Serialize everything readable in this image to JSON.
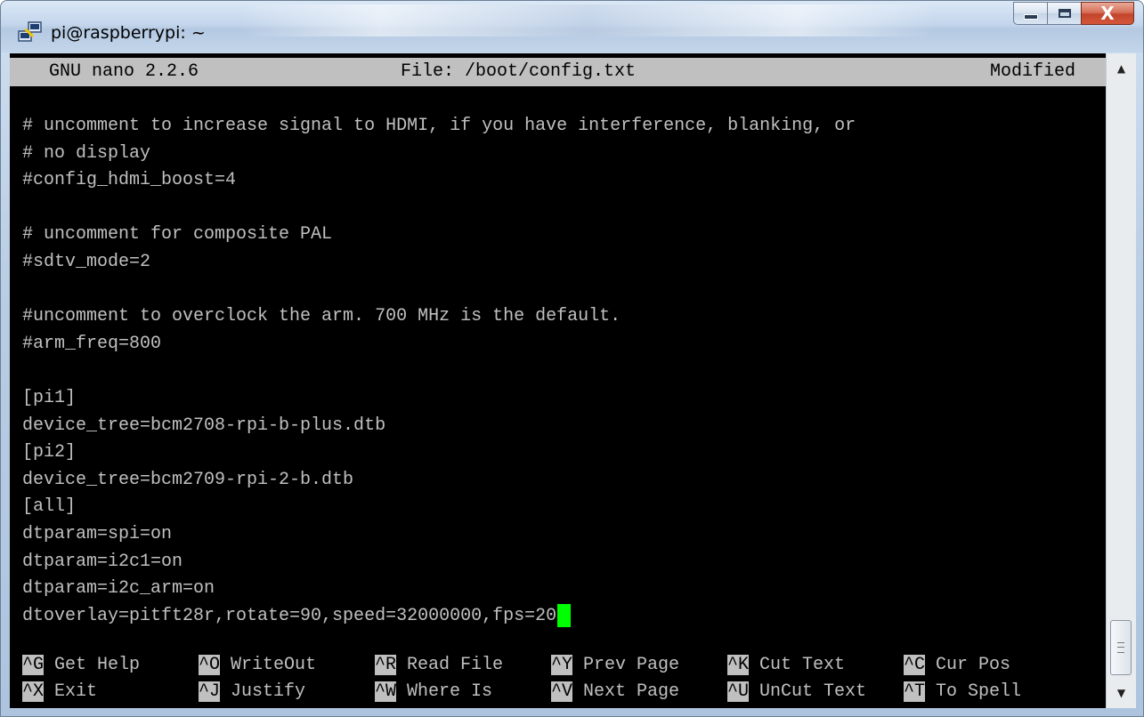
{
  "window": {
    "title": "pi@raspberrypi: ~",
    "minimize_glyph": "minimize-icon",
    "maximize_glyph": "maximize-icon",
    "close_label": "X"
  },
  "nano": {
    "version": "GNU nano 2.2.6",
    "file": "File: /boot/config.txt",
    "status": "Modified"
  },
  "lines": [
    "# uncomment to increase signal to HDMI, if you have interference, blanking, or",
    "# no display",
    "#config_hdmi_boost=4",
    "",
    "# uncomment for composite PAL",
    "#sdtv_mode=2",
    "",
    "#uncomment to overclock the arm. 700 MHz is the default.",
    "#arm_freq=800",
    "",
    "[pi1]",
    "device_tree=bcm2708-rpi-b-plus.dtb",
    "[pi2]",
    "device_tree=bcm2709-rpi-2-b.dtb",
    "[all]",
    "dtparam=spi=on",
    "dtparam=i2c1=on",
    "dtparam=i2c_arm=on",
    "dtoverlay=pitft28r,rotate=90,speed=32000000,fps=20"
  ],
  "shortcuts": [
    {
      "key": "^G",
      "label": "Get Help"
    },
    {
      "key": "^O",
      "label": "WriteOut"
    },
    {
      "key": "^R",
      "label": "Read File"
    },
    {
      "key": "^Y",
      "label": "Prev Page"
    },
    {
      "key": "^K",
      "label": "Cut Text"
    },
    {
      "key": "^C",
      "label": "Cur Pos"
    },
    {
      "key": "^X",
      "label": "Exit"
    },
    {
      "key": "^J",
      "label": "Justify"
    },
    {
      "key": "^W",
      "label": "Where Is"
    },
    {
      "key": "^V",
      "label": "Next Page"
    },
    {
      "key": "^U",
      "label": "UnCut Text"
    },
    {
      "key": "^T",
      "label": "To Spell"
    }
  ],
  "colors": {
    "terminal_bg": "#000000",
    "terminal_fg": "#c0c0c0",
    "cursor": "#00ff00"
  }
}
